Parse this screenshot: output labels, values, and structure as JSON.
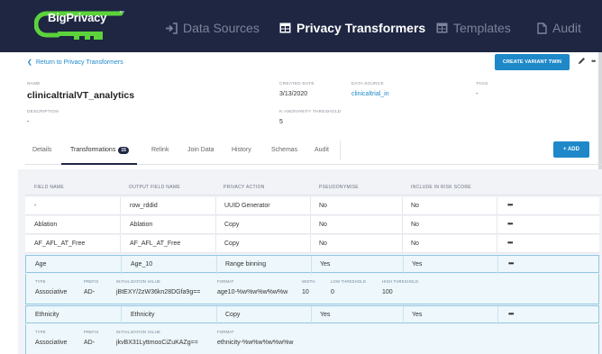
{
  "colors": {
    "nav_bg": "#1e2642",
    "accent": "#1e88c8",
    "logo_green": "#5cd33b"
  },
  "nav": {
    "logo": "BigPrivacy",
    "logo_tm": "™",
    "items": [
      {
        "label": "Data Sources",
        "icon": "sign-in-icon"
      },
      {
        "label": "Privacy Transformers",
        "icon": "table-icon"
      },
      {
        "label": "Templates",
        "icon": "table-icon"
      },
      {
        "label": "Audit",
        "icon": "document-icon"
      }
    ]
  },
  "header": {
    "back_link": "Return to Privacy Transformers",
    "create_variant_button": "CREATE VARIANT TWIN",
    "fields": {
      "name_label": "NAME",
      "name_value": "clinicaltrialVT_analytics",
      "created_label": "CREATED DATE",
      "created_value": "3/13/2020",
      "datasource_label": "DATA SOURCE",
      "datasource_value": "clinicaltrial_in",
      "tags_label": "TAGS",
      "tags_value": "-",
      "description_label": "DESCRIPTION",
      "description_value": "-",
      "kanon_label": "K-ANONYMITY THRESHOLD",
      "kanon_value": "5"
    }
  },
  "tabs": [
    {
      "label": "Details"
    },
    {
      "label": "Transformations",
      "badge": "15"
    },
    {
      "label": "Relink"
    },
    {
      "label": "Join Data"
    },
    {
      "label": "History"
    },
    {
      "label": "Schemas"
    },
    {
      "label": "Audit"
    }
  ],
  "add_button": "+ ADD",
  "table": {
    "headers": [
      "FIELD NAME",
      "OUTPUT FIELD NAME",
      "PRIVACY ACTION",
      "PSEUDONYMISE",
      "INCLUDE IN RISK SCORE"
    ],
    "rows": [
      {
        "field": "-",
        "output": "row_rddid",
        "action": "UUID Generator",
        "pseudo": "No",
        "risk": "No"
      },
      {
        "field": "Ablation",
        "output": "Ablation",
        "action": "Copy",
        "pseudo": "No",
        "risk": "No"
      },
      {
        "field": "AF_AFL_AT_Free",
        "output": "AF_AFL_AT_Free",
        "action": "Copy",
        "pseudo": "No",
        "risk": "No"
      },
      {
        "field": "Age",
        "output": "Age_10",
        "action": "Range binning",
        "pseudo": "Yes",
        "risk": "Yes"
      },
      {
        "field": "Ethnicity",
        "output": "Ethnicity",
        "action": "Copy",
        "pseudo": "Yes",
        "risk": "Yes"
      }
    ],
    "more_glyph": "•••",
    "age_detail": {
      "type_label": "TYPE",
      "type": "Associative",
      "prefix_label": "PREFIX",
      "prefix": "AD-",
      "init_label": "INITIALIZATION VALUE",
      "init": "jBtEXY/2zW36kn28DGfa9g==",
      "format_label": "FORMAT",
      "format": "age10-%w%w%w%w%w",
      "width_label": "WIDTH",
      "width": "10",
      "low_label": "LOW THRESHOLD",
      "low": "0",
      "high_label": "HIGH THRESHOLD",
      "high": "100"
    },
    "eth_detail": {
      "type_label": "TYPE",
      "type": "Associative",
      "prefix_label": "PREFIX",
      "prefix": "AD-",
      "init_label": "INITIALIZATION VALUE",
      "init": "jkvBX31LyttmooCiZuKAZg==",
      "format_label": "FORMAT",
      "format": "ethnicity-%w%w%w%w%w"
    }
  }
}
